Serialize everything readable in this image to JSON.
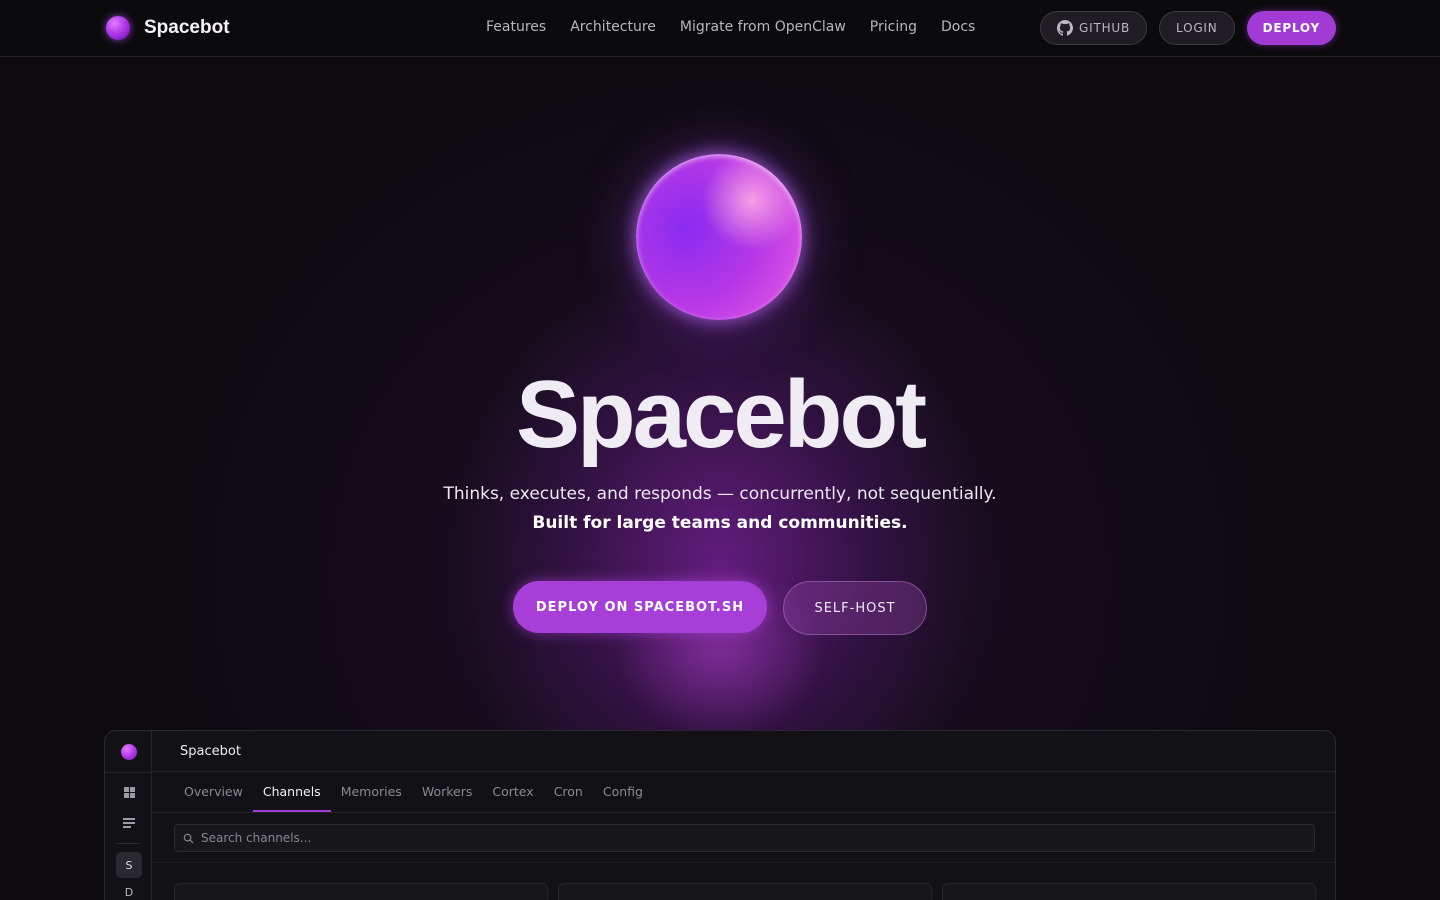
{
  "nav": {
    "brand": "Spacebot",
    "links": [
      "Features",
      "Architecture",
      "Migrate from OpenClaw",
      "Pricing",
      "Docs"
    ],
    "github_label": "GITHUB",
    "login_label": "LOGIN",
    "deploy_label": "DEPLOY"
  },
  "hero": {
    "title": "Spacebot",
    "subtitle": "Thinks, executes, and responds — concurrently, not sequentially.",
    "subtitle_bold": "Built for large teams and communities.",
    "primary_cta": "DEPLOY ON SPACEBOT.SH",
    "secondary_cta": "SELF-HOST"
  },
  "app_preview": {
    "title": "Spacebot",
    "tabs": [
      "Overview",
      "Channels",
      "Memories",
      "Workers",
      "Cortex",
      "Cron",
      "Config"
    ],
    "active_tab": "Channels",
    "search_placeholder": "Search channels...",
    "rail_items": [
      "S",
      "D"
    ]
  },
  "colors": {
    "accent": "#a23bd6",
    "background": "#0b0a0d"
  },
  "icons": [
    "spacebot-orb-icon",
    "github-icon",
    "grid-icon",
    "list-icon",
    "search-icon"
  ]
}
